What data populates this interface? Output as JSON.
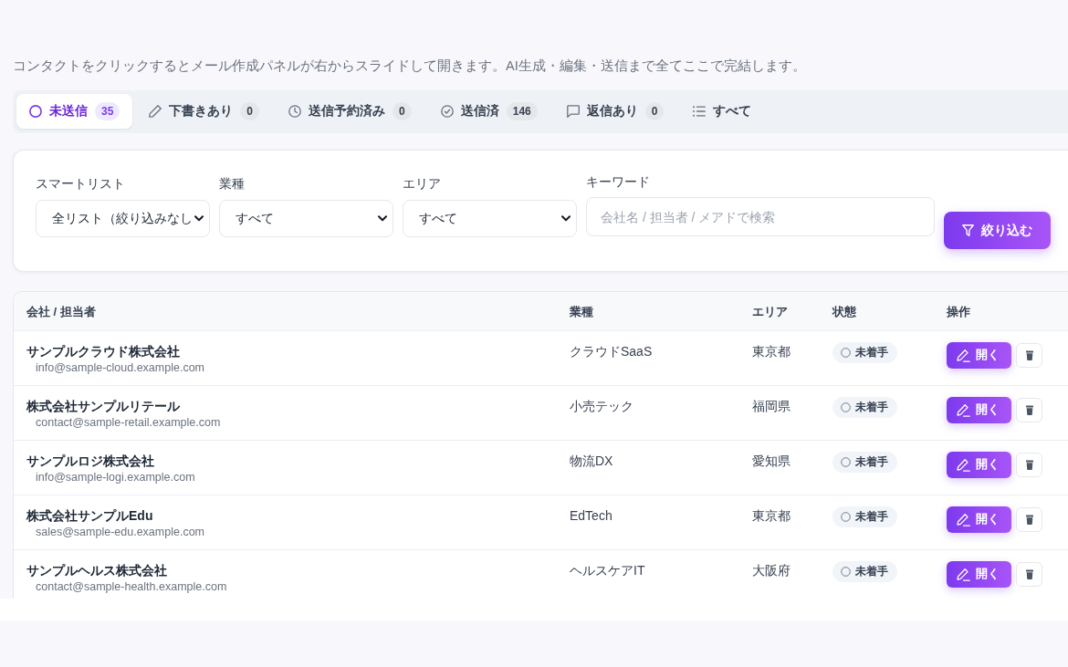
{
  "description": "コンタクトをクリックするとメール作成パネルが右からスライドして開きます。AI生成・編集・送信まで全てここで完結します。",
  "tabs": [
    {
      "label": "未送信",
      "count": "35",
      "selected": true
    },
    {
      "label": "下書きあり",
      "count": "0",
      "selected": false
    },
    {
      "label": "送信予約済み",
      "count": "0",
      "selected": false
    },
    {
      "label": "送信済",
      "count": "146",
      "selected": false
    },
    {
      "label": "返信あり",
      "count": "0",
      "selected": false
    },
    {
      "label": "すべて",
      "selected": false
    }
  ],
  "filters": {
    "fields": [
      {
        "kind": "select",
        "label": "スマートリスト",
        "value": "全リスト（絞り込みなし"
      },
      {
        "kind": "select",
        "label": "業種",
        "value": "すべて"
      },
      {
        "kind": "select",
        "label": "エリア",
        "value": "すべて"
      },
      {
        "kind": "text",
        "label": "キーワード",
        "placeholder": "会社名 / 担当者 / メアドで検索"
      }
    ],
    "button": "絞り込む"
  },
  "table": {
    "columns": [
      "会社 / 担当者",
      "業種",
      "エリア",
      "状態",
      "操作"
    ],
    "rows": [
      {
        "company": "サンプルクラウド株式会社",
        "email": "info@sample-cloud.example.com",
        "industry": "クラウドSaaS",
        "area": "東京都",
        "status": "未着手",
        "action": "開く"
      },
      {
        "company": "株式会社サンプルリテール",
        "email": "contact@sample-retail.example.com",
        "industry": "小売テック",
        "area": "福岡県",
        "status": "未着手",
        "action": "開く"
      },
      {
        "company": "サンプルロジ株式会社",
        "email": "info@sample-logi.example.com",
        "industry": "物流DX",
        "area": "愛知県",
        "status": "未着手",
        "action": "開く"
      },
      {
        "company": "株式会社サンプルEdu",
        "email": "sales@sample-edu.example.com",
        "industry": "EdTech",
        "area": "東京都",
        "status": "未着手",
        "action": "開く"
      },
      {
        "company": "サンプルヘルス株式会社",
        "email": "contact@sample-health.example.com",
        "industry": "ヘルスケアIT",
        "area": "大阪府",
        "status": "未着手",
        "action": "開く"
      }
    ]
  }
}
